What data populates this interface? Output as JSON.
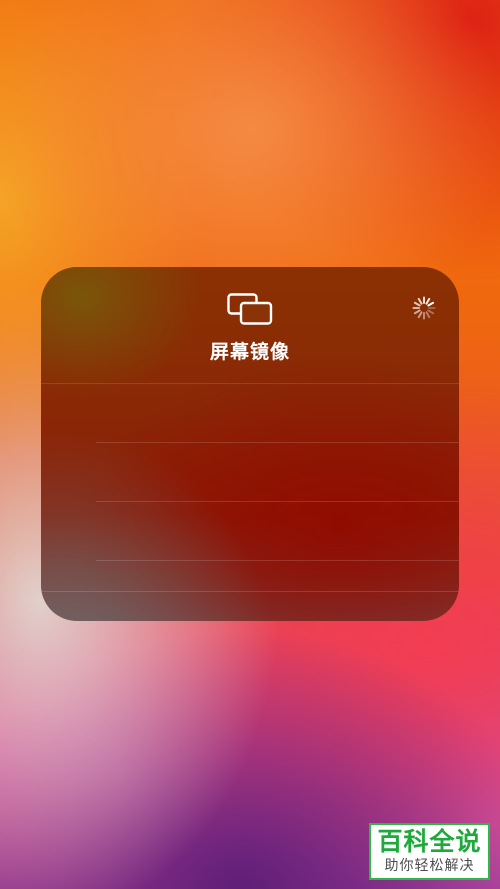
{
  "screen_mirroring": {
    "title": "屏幕镜像",
    "icon": "screen-mirroring-icon",
    "status": "loading",
    "rows": [
      {
        "label": ""
      },
      {
        "label": ""
      },
      {
        "label": ""
      },
      {
        "label": ""
      }
    ]
  },
  "watermark": {
    "title": "百科全说",
    "subtitle": "助你轻松解决"
  },
  "colors": {
    "panel_tint": "#8a2806",
    "title_text": "#ffffff",
    "watermark_green": "#1fa83b"
  }
}
